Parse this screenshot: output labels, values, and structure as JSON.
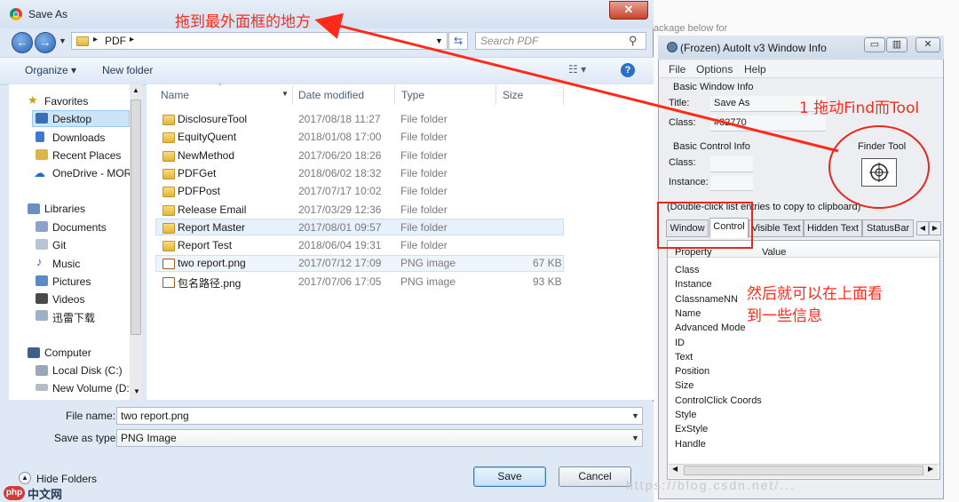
{
  "background": {
    "text": "ackage below for"
  },
  "dialog": {
    "title": "Save As",
    "address": {
      "crumb": "PDF"
    },
    "search_placeholder": "Search PDF",
    "toolbar": {
      "organize": "Organize ▾",
      "new_folder": "New folder"
    },
    "nav": {
      "favorites": "Favorites",
      "desktop": "Desktop",
      "downloads": "Downloads",
      "recent": "Recent Places",
      "onedrive": "OneDrive - MORI",
      "libraries": "Libraries",
      "documents": "Documents",
      "git": "Git",
      "music": "Music",
      "pictures": "Pictures",
      "videos": "Videos",
      "xunlei": "迅雷下载",
      "computer": "Computer",
      "local_disk": "Local Disk (C:)",
      "new_volume": "New Volume (D:)"
    },
    "columns": {
      "name": "Name",
      "date": "Date modified",
      "type": "Type",
      "size": "Size"
    },
    "files": [
      {
        "name": "DisclosureTool",
        "date": "2017/08/18 11:27",
        "type": "File folder",
        "size": ""
      },
      {
        "name": "EquityQuent",
        "date": "2018/01/08 17:00",
        "type": "File folder",
        "size": ""
      },
      {
        "name": "NewMethod",
        "date": "2017/06/20 18:26",
        "type": "File folder",
        "size": ""
      },
      {
        "name": "PDFGet",
        "date": "2018/06/02 18:32",
        "type": "File folder",
        "size": ""
      },
      {
        "name": "PDFPost",
        "date": "2017/07/17 10:02",
        "type": "File folder",
        "size": ""
      },
      {
        "name": "Release Email",
        "date": "2017/03/29 12:36",
        "type": "File folder",
        "size": ""
      },
      {
        "name": "Report Master",
        "date": "2017/08/01 09:57",
        "type": "File folder",
        "size": ""
      },
      {
        "name": "Report Test",
        "date": "2018/06/04 19:31",
        "type": "File folder",
        "size": ""
      },
      {
        "name": "two report.png",
        "date": "2017/07/12 17:09",
        "type": "PNG image",
        "size": "67 KB"
      },
      {
        "name": "包名路径.png",
        "date": "2017/07/06 17:05",
        "type": "PNG image",
        "size": "93 KB"
      }
    ],
    "file_name_label": "File name:",
    "file_name_value": "two report.png",
    "save_type_label": "Save as type:",
    "save_type_value": "PNG Image",
    "hide_folders": "Hide Folders",
    "save_button": "Save",
    "cancel_button": "Cancel"
  },
  "autoit": {
    "title": "(Frozen) AutoIt v3 Window Info",
    "menu": {
      "file": "File",
      "options": "Options",
      "help": "Help"
    },
    "basic_window": "Basic Window Info",
    "title_label": "Title:",
    "title_value": "Save As",
    "class_label": "Class:",
    "class_value": "#32770",
    "basic_control": "Basic Control Info",
    "ctrl_class_label": "Class:",
    "instance_label": "Instance:",
    "finder_tool": "Finder Tool",
    "hint": "(Double-click list entries to copy to clipboard)",
    "tabs": [
      "Window",
      "Control",
      "Visible Text",
      "Hidden Text",
      "StatusBar"
    ],
    "list_headers": {
      "property": "Property",
      "value": "Value"
    },
    "properties": [
      "Class",
      "Instance",
      "ClassnameNN",
      "Name",
      "Advanced Mode",
      "ID",
      "Text",
      "Position",
      "Size",
      "ControlClick Coords",
      "Style",
      "ExStyle",
      "Handle"
    ]
  },
  "annotations": {
    "drag_here": "拖到最外面框的地方",
    "step1": "1 拖动Find而Tool",
    "then_line1": "然后就可以在上面看",
    "then_line2": "到一些信息",
    "accent_color": "#ff2a1a"
  },
  "logo": {
    "text": "中文网",
    "badge": "php"
  }
}
